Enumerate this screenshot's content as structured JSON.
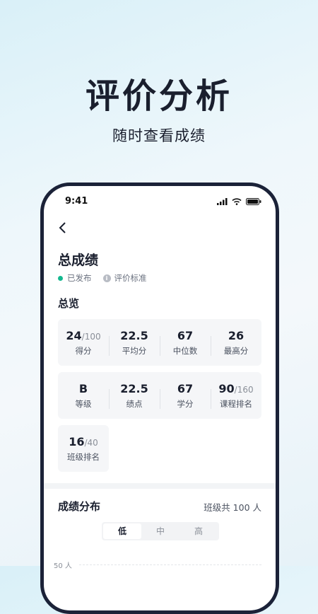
{
  "hero": {
    "title": "评价分析",
    "subtitle": "随时查看成绩"
  },
  "status_bar": {
    "time": "9:41"
  },
  "page": {
    "title": "总成绩",
    "status": "已发布",
    "criteria": "评价标准",
    "overview_title": "总览"
  },
  "stats_row1": [
    {
      "value": "24",
      "total": "/100",
      "label": "得分"
    },
    {
      "value": "22.5",
      "total": "",
      "label": "平均分"
    },
    {
      "value": "67",
      "total": "",
      "label": "中位数"
    },
    {
      "value": "26",
      "total": "",
      "label": "最高分"
    }
  ],
  "stats_row2": [
    {
      "value": "B",
      "total": "",
      "label": "等级"
    },
    {
      "value": "22.5",
      "total": "",
      "label": "绩点"
    },
    {
      "value": "67",
      "total": "",
      "label": "学分"
    },
    {
      "value": "90",
      "total": "/160",
      "label": "课程排名"
    }
  ],
  "stats_row3": [
    {
      "value": "16",
      "total": "/40",
      "label": "班级排名"
    }
  ],
  "distribution": {
    "title": "成绩分布",
    "class_total": "班级共 100 人",
    "tabs": [
      "低",
      "中",
      "高"
    ],
    "active_tab": 0,
    "y_tick": "50 人"
  },
  "colors": {
    "published": "#14b88f",
    "frame": "#1b2238",
    "text": "#1a1f2e"
  }
}
